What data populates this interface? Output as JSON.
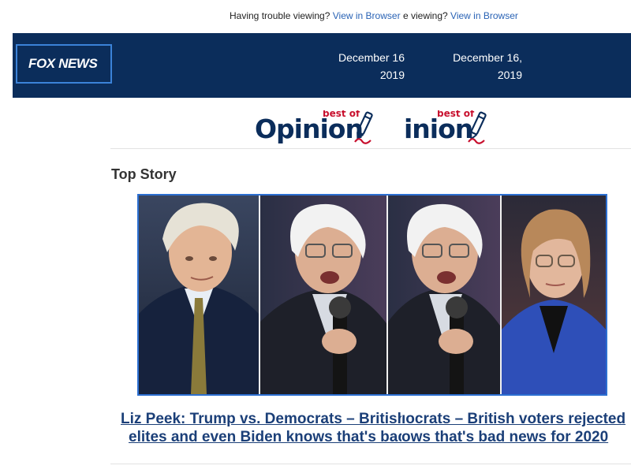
{
  "preheader": {
    "text": "Having trouble viewing?",
    "link": "View in Browser",
    "text_clipped": "e viewing?",
    "link_clipped": "View in Browser"
  },
  "header": {
    "logo": "FOX NEWS",
    "dates": [
      {
        "line1": "December 16",
        "line2": "2019"
      },
      {
        "line1": "December 16,",
        "line2": "2019"
      }
    ]
  },
  "opinion_logo": {
    "word": "Opinion",
    "word_clipped": "inion",
    "tag": "best of"
  },
  "section_title": "Top Story",
  "story": {
    "image_alt": "Boris Johnson, Bernie Sanders and Elizabeth Warren",
    "headline_line1a": "Liz Peek: Trump vs. Democrats – British",
    "headline_line1b": "ıocrats – British voters rejected",
    "headline_line2a": "elites and even Biden knows that's bad n",
    "headline_line2b": "ows that's bad news for 2020"
  },
  "colors": {
    "band": "#0b2d5b",
    "link": "#2a63b5",
    "accent": "#c8102e",
    "headline": "#1b3f78"
  }
}
